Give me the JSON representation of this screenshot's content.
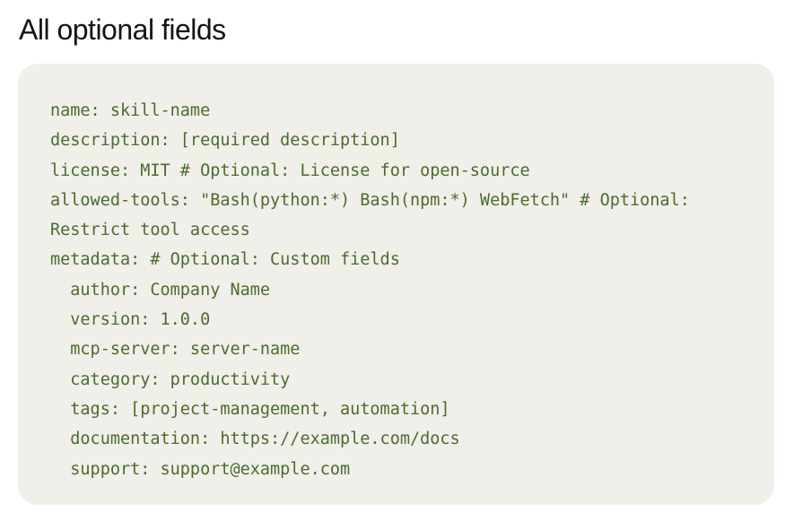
{
  "heading": "All optional fields",
  "code": {
    "lines": [
      "name: skill-name",
      "description: [required description]",
      "license: MIT # Optional: License for open-source",
      "allowed-tools: \"Bash(python:*) Bash(npm:*) WebFetch\" # Optional:",
      "Restrict tool access",
      "metadata: # Optional: Custom fields",
      "  author: Company Name",
      "  version: 1.0.0",
      "  mcp-server: server-name",
      "  category: productivity",
      "  tags: [project-management, automation]",
      "  documentation: https://example.com/docs",
      "  support: support@example.com"
    ]
  },
  "colors": {
    "code_text": "#4c6b2c",
    "code_background": "#f0efea",
    "heading_text": "#141413"
  }
}
